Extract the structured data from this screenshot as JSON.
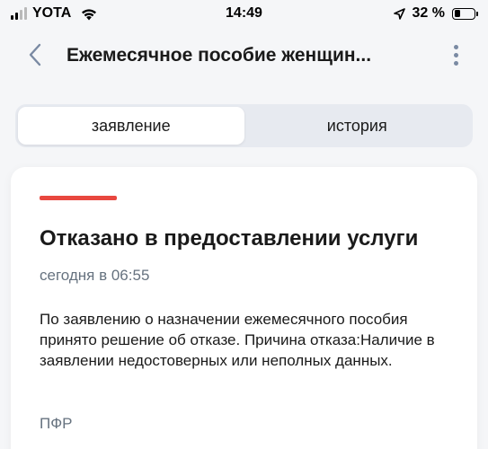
{
  "status_bar": {
    "carrier": "YOTA",
    "time": "14:49",
    "battery_percent": "32 %",
    "battery_level": 0.32
  },
  "header": {
    "title": "Ежемесячное пособие женщин..."
  },
  "tabs": [
    {
      "label": "заявление",
      "active": true
    },
    {
      "label": "история",
      "active": false
    }
  ],
  "card": {
    "status_color": "#e8473f",
    "title": "Отказано в предоставлении услуги",
    "date": "сегодня в 06:55",
    "text": "По заявлению о назначении ежемесячного пособия принято решение об отказе. Причина отказа:Наличие в заявлении недостоверных или неполных данных.",
    "source": "ПФР"
  },
  "icons": {
    "back": "chevron-left-icon",
    "more": "more-vertical-icon",
    "wifi": "wifi-icon",
    "location": "location-arrow-icon",
    "battery": "battery-icon",
    "signal": "signal-icon"
  }
}
